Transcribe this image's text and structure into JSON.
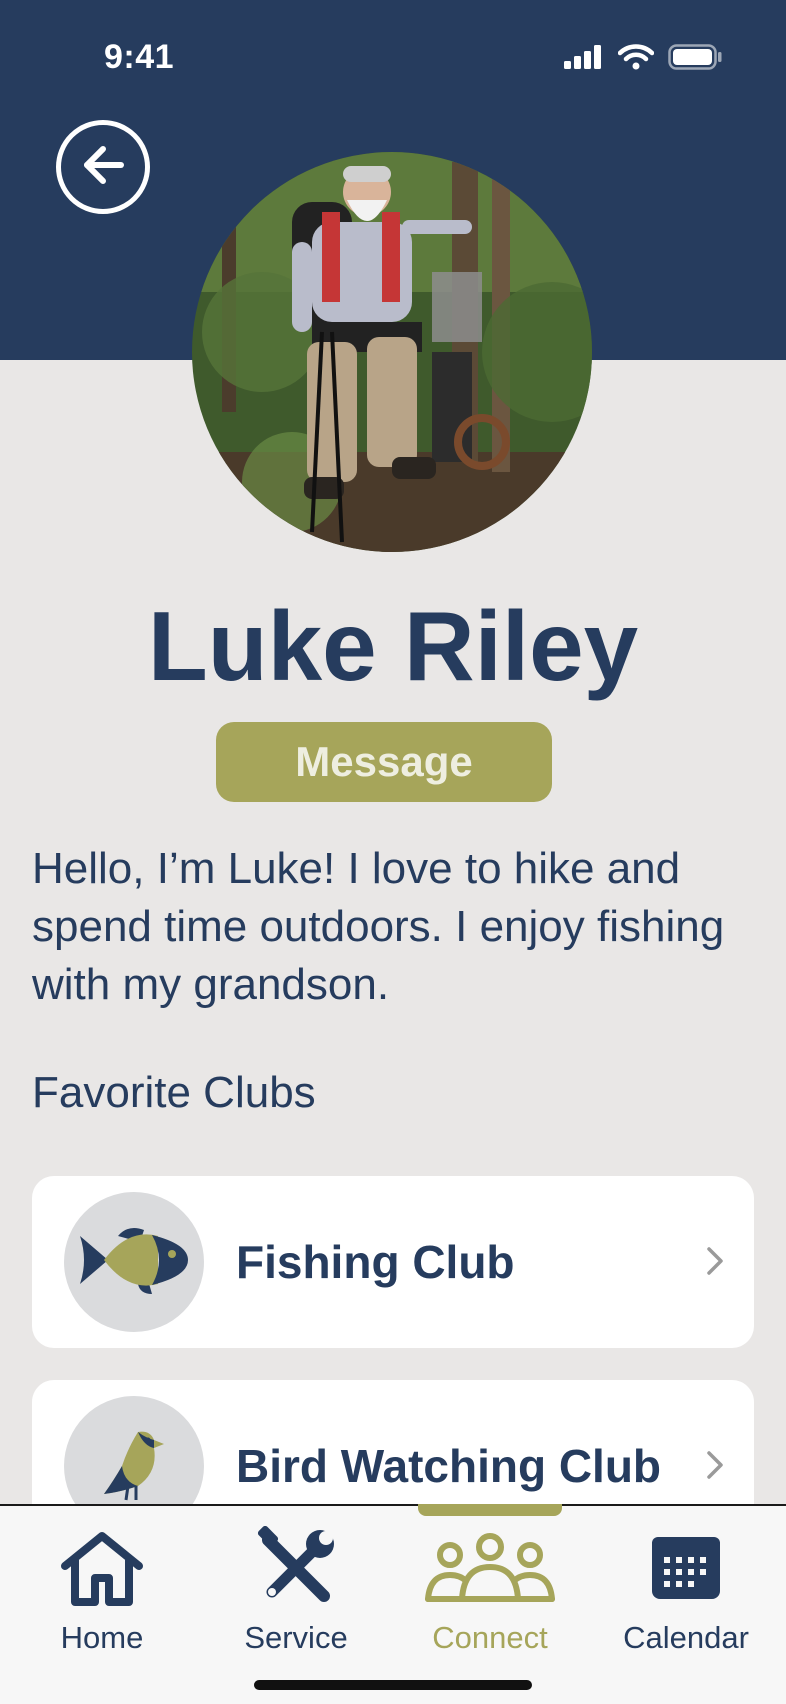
{
  "status_bar": {
    "time": "9:41"
  },
  "profile": {
    "name": "Luke Riley",
    "message_label": "Message",
    "bio": "Hello, I’m Luke! I love to hike and spend time outdoors. I enjoy fishing with my grandson."
  },
  "favorite_clubs": {
    "title": "Favorite Clubs",
    "items": [
      {
        "label": "Fishing Club",
        "icon": "fish-icon"
      },
      {
        "label": "Bird Watching Club",
        "icon": "bird-icon"
      }
    ]
  },
  "tab_bar": {
    "active": "Connect",
    "tabs": [
      {
        "label": "Home",
        "icon": "home-icon"
      },
      {
        "label": "Service",
        "icon": "tools-icon"
      },
      {
        "label": "Connect",
        "icon": "people-icon"
      },
      {
        "label": "Calendar",
        "icon": "calendar-icon"
      }
    ]
  },
  "colors": {
    "navy": "#263c5e",
    "olive": "#a6a55a",
    "background": "#e9e7e6",
    "card": "#ffffff"
  }
}
